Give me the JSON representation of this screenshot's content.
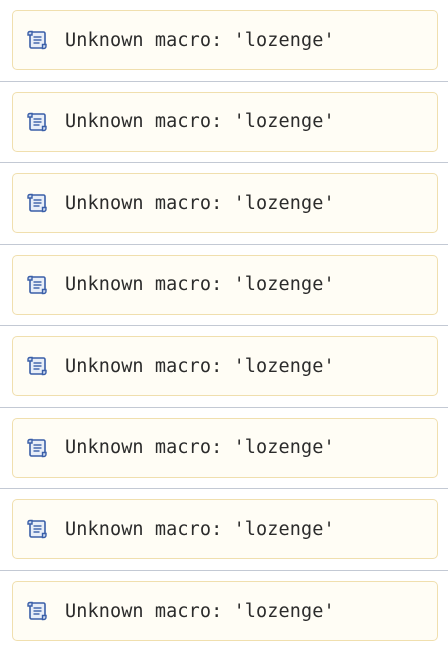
{
  "items": [
    {
      "icon": "scroll-icon",
      "text": "Unknown macro: 'lozenge'"
    },
    {
      "icon": "scroll-icon",
      "text": "Unknown macro: 'lozenge'"
    },
    {
      "icon": "scroll-icon",
      "text": "Unknown macro: 'lozenge'"
    },
    {
      "icon": "scroll-icon",
      "text": "Unknown macro: 'lozenge'"
    },
    {
      "icon": "scroll-icon",
      "text": "Unknown macro: 'lozenge'"
    },
    {
      "icon": "scroll-icon",
      "text": "Unknown macro: 'lozenge'"
    },
    {
      "icon": "scroll-icon",
      "text": "Unknown macro: 'lozenge'"
    },
    {
      "icon": "scroll-icon",
      "text": "Unknown macro: 'lozenge'"
    }
  ],
  "colors": {
    "box_background": "#fffdf5",
    "box_border": "#f0dfae",
    "divider": "#c3c9d4",
    "icon_blue": "#3a5fa8"
  }
}
